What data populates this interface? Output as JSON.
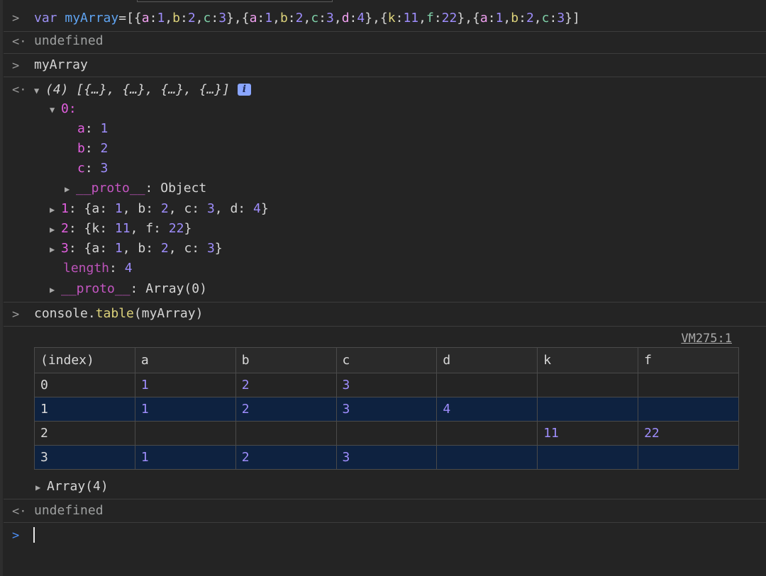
{
  "prompt_symbol": ">",
  "result_symbol": "<·",
  "lines": {
    "cmd1": {
      "kw": "var",
      "name": "myArray",
      "rest": "=[{a:1,b:2,c:3},{a:1,b:2,c:3,d:4},{k:11,f:22},{a:1,b:2,c:3}]"
    },
    "undefined1": "undefined",
    "cmd2": "myArray",
    "summary": "(4) [{…}, {…}, {…}, {…}]",
    "info_badge": "i",
    "item0_label": "0:",
    "item0_props": [
      {
        "k": "a",
        "v": "1"
      },
      {
        "k": "b",
        "v": "2"
      },
      {
        "k": "c",
        "v": "3"
      }
    ],
    "item0_proto_key": "__proto__",
    "item0_proto_val": "Object",
    "items": [
      {
        "idx": "1",
        "text": "{a: 1, b: 2, c: 3, d: 4}"
      },
      {
        "idx": "2",
        "text": "{k: 11, f: 22}"
      },
      {
        "idx": "3",
        "text": "{a: 1, b: 2, c: 3}"
      }
    ],
    "length_key": "length",
    "length_val": "4",
    "array_proto_key": "__proto__",
    "array_proto_val": "Array(0)",
    "cmd3_obj": "console.",
    "cmd3_fn": "table",
    "cmd3_args": "(myArray)",
    "vm_link": "VM275:1",
    "array_summary": "Array(4)",
    "undefined2": "undefined"
  },
  "table": {
    "headers": [
      "(index)",
      "a",
      "b",
      "c",
      "d",
      "k",
      "f"
    ],
    "rows": [
      [
        "0",
        "1",
        "2",
        "3",
        "",
        "",
        ""
      ],
      [
        "1",
        "1",
        "2",
        "3",
        "4",
        "",
        ""
      ],
      [
        "2",
        "",
        "",
        "",
        "",
        "11",
        "22"
      ],
      [
        "3",
        "1",
        "2",
        "3",
        "",
        "",
        ""
      ]
    ]
  },
  "colors": {
    "background": "#242424",
    "selected_row": "#0e2240",
    "number": "#9e8dfc",
    "property": "#e25fdf",
    "prompt": "#4d8ff7"
  }
}
